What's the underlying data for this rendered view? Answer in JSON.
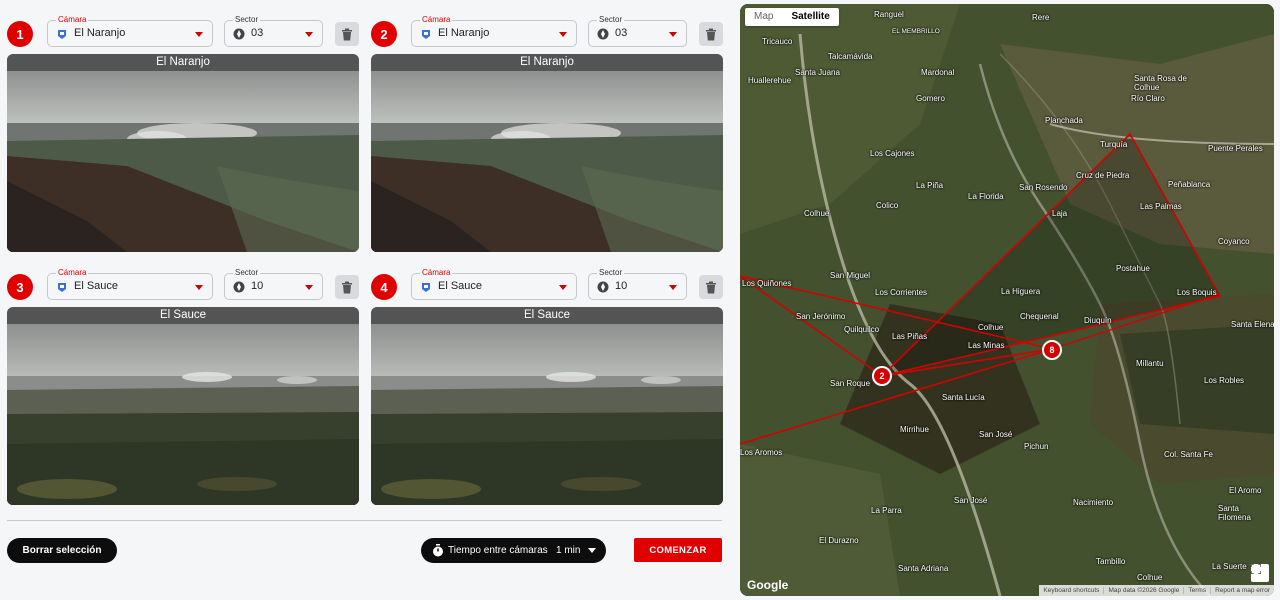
{
  "cameras": [
    {
      "index": "1",
      "camera_label": "Cámara",
      "camera_value": "El Naranjo",
      "sector_label": "Sector",
      "sector_value": "03",
      "image_title": "El Naranjo"
    },
    {
      "index": "2",
      "camera_label": "Cámara",
      "camera_value": "El Naranjo",
      "sector_label": "Sector",
      "sector_value": "03",
      "image_title": "El Naranjo"
    },
    {
      "index": "3",
      "camera_label": "Cámara",
      "camera_value": "El Sauce",
      "sector_label": "Sector",
      "sector_value": "10",
      "image_title": "El Sauce"
    },
    {
      "index": "4",
      "camera_label": "Cámara",
      "camera_value": "El Sauce",
      "sector_label": "Sector",
      "sector_value": "10",
      "image_title": "El Sauce"
    }
  ],
  "footer": {
    "clear_label": "Borrar selección",
    "timer_label": "Tiempo entre cámaras",
    "timer_value": "1 min",
    "start_label": "COMENZAR"
  },
  "map": {
    "toggle_map": "Map",
    "toggle_satellite": "Satellite",
    "google_logo": "Google",
    "attribution": [
      "Keyboard shortcuts",
      "Map data ©2026 Google",
      "Terms",
      "Report a map error"
    ],
    "marker_a": "2",
    "marker_b": "8",
    "places": [
      "Ranguel",
      "Rere",
      "Tricauco",
      "Talcamávida",
      "EL MEMBRILLO",
      "Huallerehue",
      "Santa Juana",
      "Mardonal",
      "Santa Rosa de Colhue",
      "Río Claro",
      "Gomero",
      "Planchada",
      "Los Cajones",
      "Turquía",
      "Puente Perales",
      "San Rosendo",
      "Cruz de Piedra",
      "Peñablanca",
      "La Piña",
      "La Florida",
      "Laja",
      "Colico",
      "Las Palmas",
      "Colhue",
      "Coyanco",
      "Postahue",
      "San Miguel",
      "Los Quiñones",
      "Los Corrientes",
      "La Higuera",
      "Los Boquis",
      "San Jerónimo",
      "Chequenal",
      "Diuquín",
      "Santa Elena",
      "Quilquilco",
      "Colhue",
      "Las Piñas",
      "Las Minas",
      "Millantu",
      "San Roque",
      "Los Robles",
      "Santa Lucía",
      "Mirrihue",
      "San José",
      "Pichun",
      "Los Aromos",
      "Col. Santa Fe",
      "El Aromo",
      "San José",
      "Nacimiento",
      "Santa Filomena",
      "La Parra",
      "El Durazno",
      "Tambillo",
      "Santa Adriana",
      "Colhue",
      "La Suerte"
    ]
  },
  "colors": {
    "accent": "#e00000",
    "dark_button": "#0d0d0d",
    "image_title_bar": "#545454"
  }
}
